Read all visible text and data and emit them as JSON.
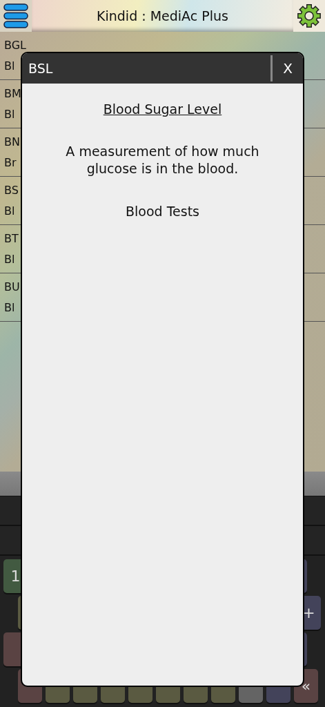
{
  "app_bar": {
    "title": "Kindid : MediAc Plus"
  },
  "list": {
    "rows": [
      {
        "code": "BGL",
        "name": "Bl"
      },
      {
        "code": "BM",
        "name": "Bl"
      },
      {
        "code": "BN",
        "name": "Br"
      },
      {
        "code": "BS",
        "name": "Bl"
      },
      {
        "code": "BT",
        "name": "Bl"
      },
      {
        "code": "BU",
        "name": "Bl"
      }
    ]
  },
  "keyboard": {
    "rows": [
      {
        "left": [
          {
            "label": "1",
            "color": "#425a41"
          }
        ],
        "right": [
          {
            "color": "#43435a"
          }
        ]
      },
      {
        "left": [
          {
            "color": "#5a5a41"
          }
        ],
        "right": [
          {
            "label": "+",
            "color": "#43435a"
          }
        ]
      },
      {
        "left": [
          {
            "color": "#5a4343"
          }
        ],
        "right": [
          {
            "color": "#43435a"
          }
        ]
      },
      {
        "left": [
          {
            "color": "#5a4343"
          },
          {
            "color": "#5a5a41"
          },
          {
            "color": "#5a5a41"
          },
          {
            "color": "#5a5a41"
          },
          {
            "color": "#5a5a41"
          },
          {
            "color": "#5a5a41"
          },
          {
            "color": "#5a5a41"
          },
          {
            "color": "#5a5a41"
          },
          {
            "color": "#646464"
          },
          {
            "color": "#43435a"
          },
          {
            "label": "«",
            "color": "#5a4343"
          }
        ],
        "right": []
      }
    ]
  },
  "dialog": {
    "title": "BSL",
    "close": "X",
    "term": "Blood Sugar Level",
    "definition": "A measurement of how much glucose is in the blood.",
    "category": "Blood Tests"
  }
}
